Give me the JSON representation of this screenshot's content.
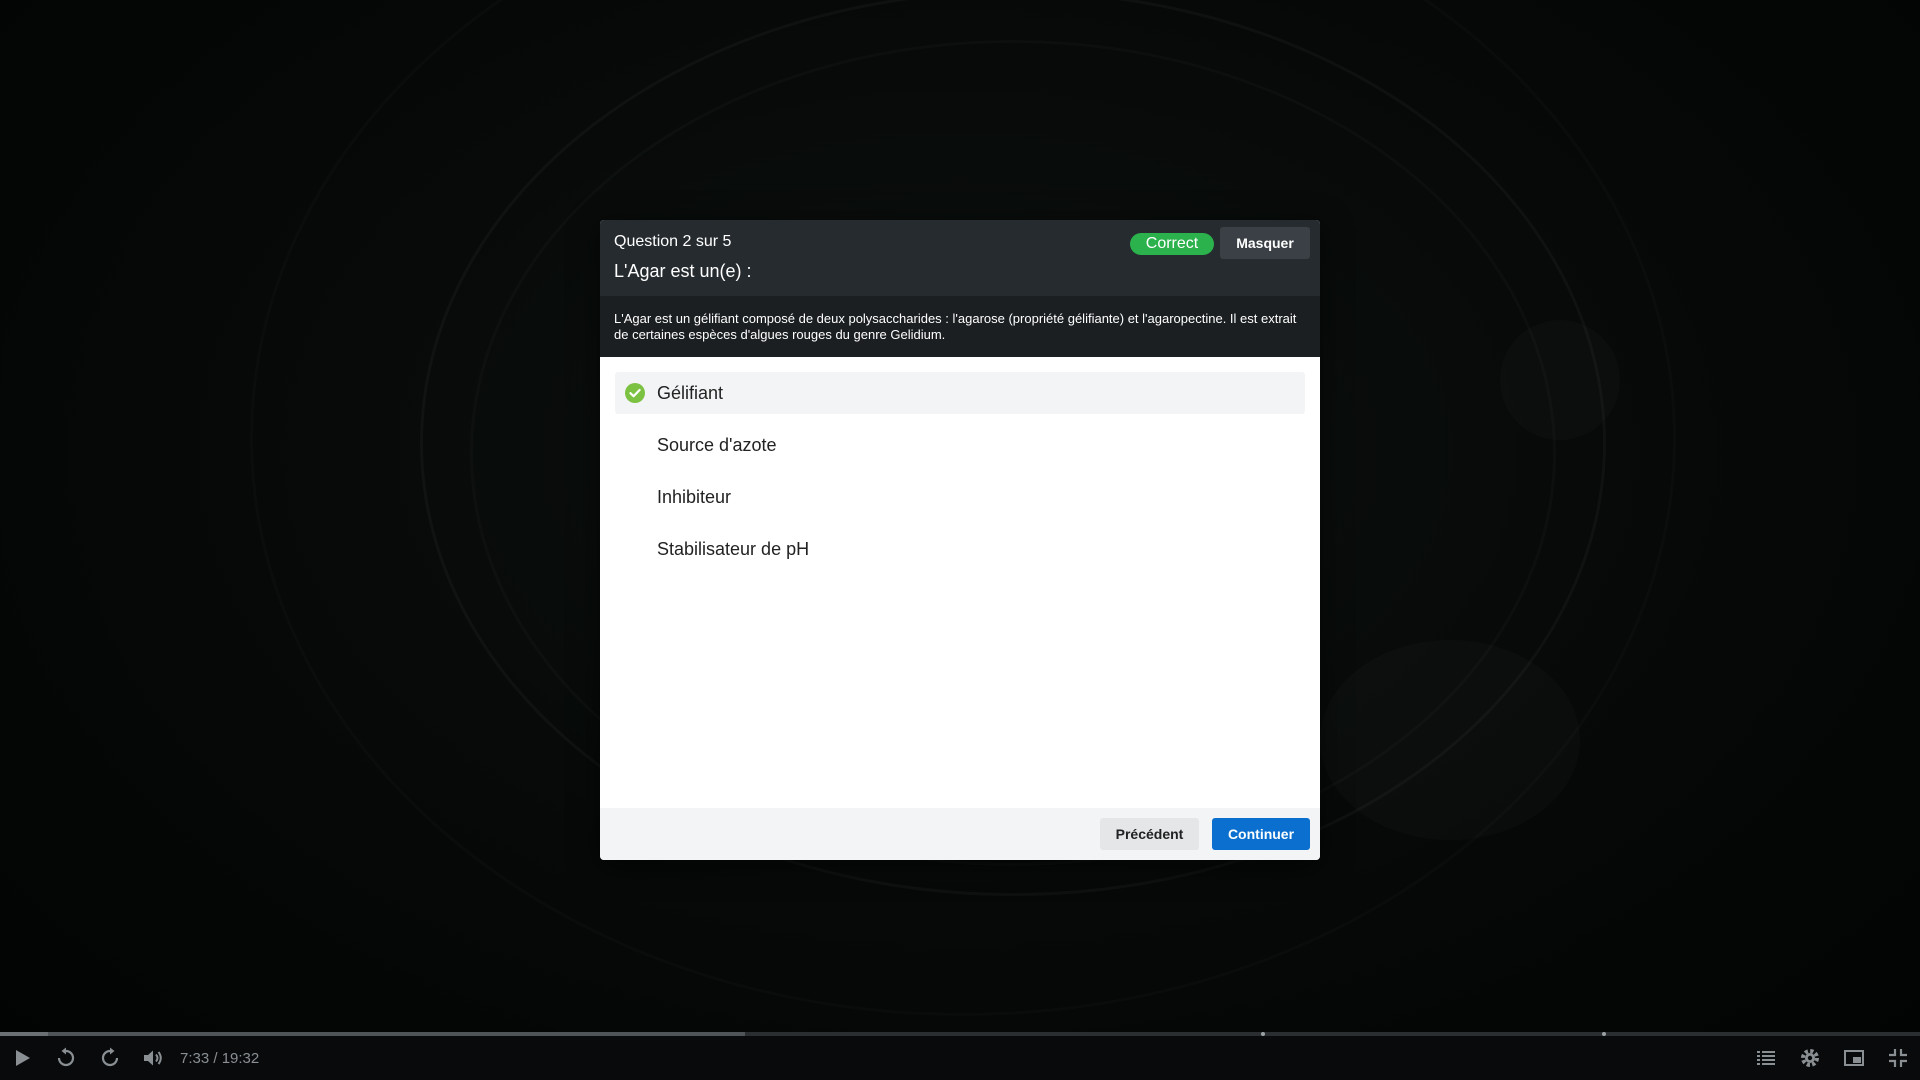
{
  "quiz": {
    "counter": "Question 2 sur 5",
    "title": "L'Agar est un(e) :",
    "status_badge": "Correct",
    "hide_label": "Masquer",
    "feedback": "L'Agar est un gélifiant composé de deux polysaccharides : l'agarose (propriété gélifiante) et l'agaropectine. Il est extrait de certaines espèces d'algues rouges du genre Gelidium.",
    "answers": [
      {
        "label": "Gélifiant",
        "selected": true,
        "correct": true
      },
      {
        "label": "Source d'azote",
        "selected": false
      },
      {
        "label": "Inhibiteur",
        "selected": false
      },
      {
        "label": "Stabilisateur de pH",
        "selected": false
      }
    ],
    "prev_label": "Précédent",
    "next_label": "Continuer"
  },
  "player": {
    "time": "7:33 / 19:32",
    "progress_fraction": 0.388,
    "icons": [
      "play-icon",
      "rewind-icon",
      "forward-icon",
      "volume-icon",
      "chapters-icon",
      "settings-icon",
      "picture-in-picture-icon",
      "exit-fullscreen-icon"
    ]
  },
  "colors": {
    "correct": "#2bb24c",
    "primary": "#0a6fcf",
    "header_bg": "#262b2f",
    "check": "#7cc242"
  }
}
